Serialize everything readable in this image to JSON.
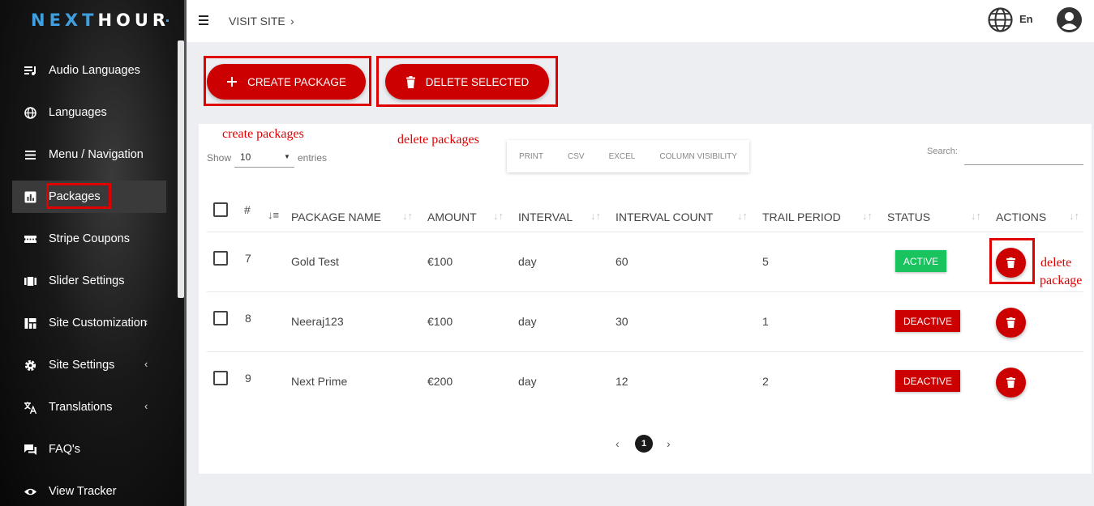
{
  "brand": {
    "logo_part1": "NEXT",
    "logo_part2": "HOUR"
  },
  "sidebar": {
    "items": [
      {
        "label": "Audio Languages",
        "icon": "audio-list-icon"
      },
      {
        "label": "Languages",
        "icon": "globe-icon"
      },
      {
        "label": "Menu / Navigation",
        "icon": "menu-icon"
      },
      {
        "label": "Packages",
        "icon": "bar-chart-icon",
        "active": true
      },
      {
        "label": "Stripe Coupons",
        "icon": "coupon-icon"
      },
      {
        "label": "Slider Settings",
        "icon": "slider-icon"
      },
      {
        "label": "Site Customization",
        "icon": "dashboard-icon",
        "chevron": "‹"
      },
      {
        "label": "Site Settings",
        "icon": "gear-icon",
        "chevron": "‹"
      },
      {
        "label": "Translations",
        "icon": "translate-icon",
        "chevron": "‹"
      },
      {
        "label": "FAQ's",
        "icon": "chat-icon"
      },
      {
        "label": "View Tracker",
        "icon": "eye-icon"
      }
    ]
  },
  "header": {
    "visit_site": "VISIT SITE",
    "visit_chevron": "›",
    "language": "En"
  },
  "actions": {
    "create_label": "CREATE PACKAGE",
    "delete_label": "DELETE SELECTED"
  },
  "annotations": {
    "create": "create packages",
    "delete": "delete packages",
    "delete_row_1": "delete",
    "delete_row_2": "package"
  },
  "table_controls": {
    "show": "Show",
    "entries_value": "10",
    "entries": "entries",
    "tools": [
      "PRINT",
      "CSV",
      "EXCEL",
      "COLUMN VISIBILITY"
    ],
    "search_label": "Search:",
    "search_value": ""
  },
  "table": {
    "columns": [
      "#",
      "PACKAGE NAME",
      "AMOUNT",
      "INTERVAL",
      "INTERVAL COUNT",
      "TRAIL PERIOD",
      "STATUS",
      "ACTIONS"
    ],
    "rows": [
      {
        "id": "7",
        "name": "Gold Test",
        "amount": "€100",
        "interval": "day",
        "count": "60",
        "trial": "5",
        "status": "ACTIVE"
      },
      {
        "id": "8",
        "name": "Neeraj123",
        "amount": "€100",
        "interval": "day",
        "count": "30",
        "trial": "1",
        "status": "DEACTIVE"
      },
      {
        "id": "9",
        "name": "Next Prime",
        "amount": "€200",
        "interval": "day",
        "count": "12",
        "trial": "2",
        "status": "DEACTIVE"
      }
    ]
  },
  "pagination": {
    "prev": "‹",
    "current": "1",
    "next": "›"
  },
  "colors": {
    "accent": "#cc0000",
    "active": "#19c35e",
    "logo_blue": "#3f9fe0"
  }
}
